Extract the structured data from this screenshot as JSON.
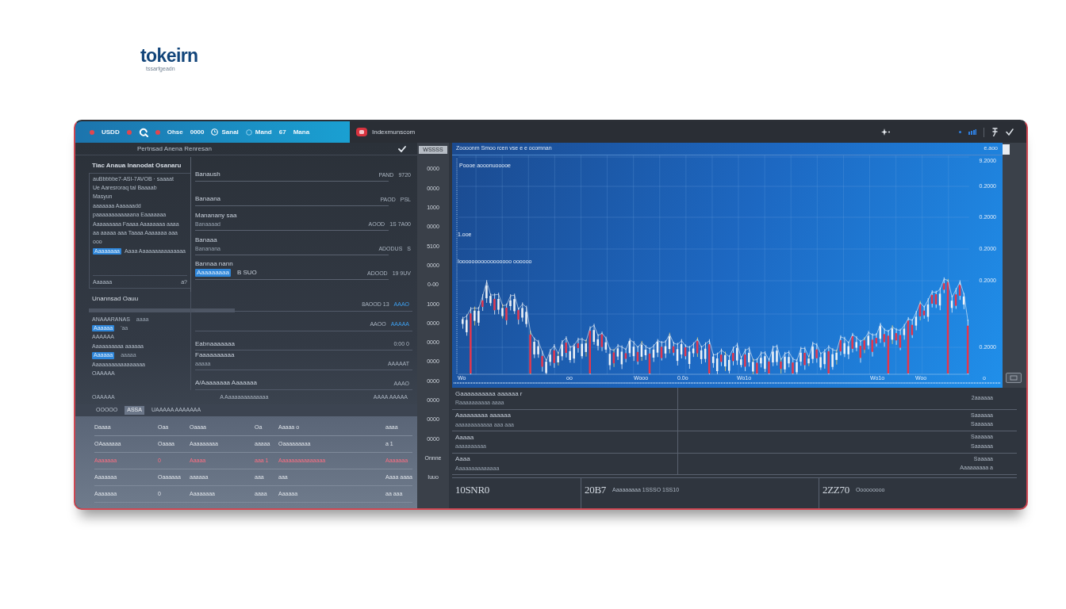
{
  "logo": {
    "wordmark": "tokeirn",
    "tagline": "tssarfgeadn"
  },
  "top_bar": {
    "nav_items": [
      {
        "kind": "dot"
      },
      {
        "kind": "text",
        "label": "USDD"
      },
      {
        "kind": "dot"
      },
      {
        "kind": "search"
      },
      {
        "kind": "dot"
      },
      {
        "kind": "text",
        "label": "Ohse"
      },
      {
        "kind": "text",
        "label": "0000"
      },
      {
        "kind": "clock",
        "label": "Sanal"
      },
      {
        "kind": "ring",
        "label": "Mand"
      },
      {
        "kind": "text",
        "label": "67"
      },
      {
        "kind": "text",
        "label": "Mana"
      }
    ],
    "title": "Indexmunscom"
  },
  "left_panel": {
    "header": "Pertnsad Anena Renresan",
    "summary": {
      "title": "Tiac Anaua Inanodat Osanaru",
      "lines": [
        "auBbbbbe7-ASI-7AVOB · saaaat",
        "Ue Aaresroraq tal Baaaab",
        "Masyun",
        "aaaaaaa Aaaaaadd",
        "paaaaaaaaaaaana Eaaaaaaa",
        "Aaaaaaaaa Faaaa Aaaaaaaa aaaa",
        "aa aaaaa aaa Taaaa Aaaaaaa aaa",
        "ooo"
      ],
      "tag": "Aaaaaaaa",
      "tag_text": "Aaaa Aaaaaaaaaaaaaaa",
      "footer": "Aaaaaa",
      "footer_value": "a?"
    },
    "list": [
      {
        "title": "Banaush",
        "value": "PAND",
        "value_2": "9720"
      },
      {
        "title": "Banaana",
        "value": "PAOD",
        "value_2": "PSL"
      },
      {
        "title": "Mananany saa",
        "subtitle": "Banaaaad",
        "value": "AOOD",
        "value_2": "1S 7A00"
      },
      {
        "title": "Banaaa",
        "subtitle": "Bananana",
        "value": "ADODUS",
        "value_2": "S"
      },
      {
        "title": "Bannaa nann",
        "tag": "Aaaaaaaaa",
        "tag_note": "B SUO",
        "value": "ADOOD",
        "value_2": "19 9UV"
      }
    ],
    "watch": {
      "title": "Unannsad Oauu",
      "items": [
        {
          "label": "ANAAARANAS",
          "note": "aaaa"
        },
        {
          "tag": "Aaaaaa",
          "note": "'aa"
        },
        {
          "label": "AAAAAA"
        },
        {
          "label": "Aaaaaaaaaa aaaaaa"
        },
        {
          "tag": "Aaaaaa",
          "note": "aaaaa"
        },
        {
          "label": "Aaaaaaaaaaaaaaaaa"
        },
        {
          "label": "OAAAAA"
        }
      ],
      "rows": [
        {
          "value": "8AOOD 13",
          "tag": "AAAO"
        },
        {
          "value": "AAOO",
          "tag": "AAAAA"
        },
        {
          "title": "Eabnaaaaaaa",
          "value": "0:00 0"
        },
        {
          "title": "Faaaaaaaaaa",
          "subtitle": "aaaaa",
          "value": "AAAAAT"
        },
        {
          "title": "A/Aaaaaaaa Aaaaaaa",
          "value": "AAAO"
        }
      ],
      "footer": [
        "OAAAAA",
        "A Aaaaaaaaaaaaaa",
        "AAAA AAAAA"
      ]
    },
    "table": {
      "tabs": [
        {
          "label": "OOOOO",
          "selected": false
        },
        {
          "label": "ASSA",
          "selected": true
        },
        {
          "label": "UAAAAA AAAAAAA",
          "selected": false
        }
      ],
      "rows": [
        {
          "alert": false,
          "cells": [
            "Daaaa",
            "Oaa",
            "Oaaaa",
            "Oa",
            "Aaaaa o",
            "aaaa"
          ]
        },
        {
          "alert": false,
          "cells": [
            "OAaaaaaa",
            "Oaaaa",
            "Aaaaaaaaa",
            "aaaaa",
            "Oaaaaaaaaa",
            "a 1"
          ]
        },
        {
          "alert": true,
          "cells": [
            "Aaaaaaa",
            "0",
            "Aaaaa",
            "aaa 1",
            "Aaaaaaaaaaaaaaa",
            "Aaaaaaa"
          ]
        },
        {
          "alert": false,
          "cells": [
            "Aaaaaaa",
            "Oaaaaaa",
            "aaaaaa",
            "aaa",
            "aaa",
            "Aaaa aaaa"
          ]
        },
        {
          "alert": false,
          "cells": [
            "Aaaaaaa",
            "0",
            "Aaaaaaaa",
            "aaaa",
            "Aaaaaa",
            "aa aaa"
          ]
        }
      ]
    }
  },
  "axis_labels": [
    {
      "label": "WSSSS",
      "selected": true
    },
    {
      "label": "0000",
      "selected": false
    },
    {
      "label": "0000",
      "selected": false
    },
    {
      "label": "1000",
      "selected": false
    },
    {
      "label": "0000",
      "selected": false
    },
    {
      "label": "5100",
      "selected": false
    },
    {
      "label": "0000",
      "selected": false
    },
    {
      "label": "0-00",
      "selected": false
    },
    {
      "label": "1000",
      "selected": false
    },
    {
      "label": "0000",
      "selected": false
    },
    {
      "label": "0000",
      "selected": false
    },
    {
      "label": "0000",
      "selected": false
    },
    {
      "label": "0000",
      "selected": false
    },
    {
      "label": "0000",
      "selected": false
    },
    {
      "label": "0000",
      "selected": false
    },
    {
      "label": "0000",
      "selected": false
    },
    {
      "label": "Onnne",
      "selected": false
    },
    {
      "label": "Iuuo",
      "selected": false
    }
  ],
  "chart": {
    "title": "Zoooonm Smoo rcen vse e e ocomnan",
    "corner_label": "e.aoo",
    "annotations": [
      "Poooe aooonuooooe",
      "1.ooe",
      "Iooooooooooooooooo oooooo"
    ],
    "y_labels": [
      "9.2000",
      "0.2000",
      "0.2000",
      "0.2000",
      "0.2000",
      "0.2000"
    ],
    "x_labels": [
      "Wo",
      "oo",
      "Wooo",
      "0.0o",
      "Wo1o",
      "Wo1o",
      "Woo",
      "o"
    ]
  },
  "details": [
    {
      "title": "Gaaaaaaaaaa aaaaaa r",
      "subtitle": "Raaaaaaaaaa aaaa",
      "value": "2aaaaaa"
    },
    {
      "title": "Aaaaaaaaa aaaaaa",
      "subtitle": "aaaaaaaaaaaa aaa aaa",
      "value": "Saaaaaa",
      "value_2": "Saaaaaa"
    },
    {
      "title": "Aaaaa",
      "subtitle": "aaaaaaaaaa",
      "value": "Saaaaaa",
      "value_2": "Saaaaaa"
    },
    {
      "title": "Aaaa",
      "subtitle": "Aaaaaaaaaaaaaa",
      "value": "Saaaaa",
      "value_2": "Aaaaaaaaa a"
    }
  ],
  "stats": [
    {
      "value": "10SNR0"
    },
    {
      "value": "20B7",
      "label": "Aaaaaaaaa 1SSSO 1SS10"
    },
    {
      "value": "2ZZ70",
      "label": "Ooooooooo"
    }
  ]
}
